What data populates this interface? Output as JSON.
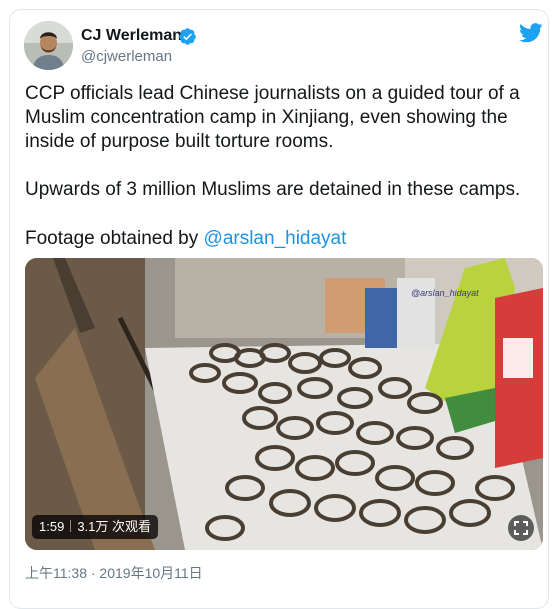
{
  "tweet": {
    "author_name": "CJ Werleman",
    "author_handle": "@cjwerleman",
    "paragraph_1": "CCP officials lead Chinese journalists on a guided tour of a Muslim concentration camp in Xinjiang, even showing the inside of purpose built torture rooms.",
    "paragraph_2": "Upwards of 3 million Muslims are detained in these camps.",
    "paragraph_3_prefix": "Footage obtained by ",
    "mention": "@arslan_hidayat",
    "timestamp": "上午11:38 · 2019年10月11日"
  },
  "video": {
    "duration": "1:59",
    "views": "3.1万 次观看",
    "watermark": "@arslan_hidayat"
  },
  "colors": {
    "link": "#1b95e0",
    "verified": "#1da1f2",
    "twitter_brand": "#1da1f2",
    "secondary_text": "#657786",
    "border": "#e1e8ed"
  },
  "icons": {
    "verified": "verified-badge-icon",
    "brand": "twitter-bird-icon",
    "expand": "fullscreen-icon"
  }
}
